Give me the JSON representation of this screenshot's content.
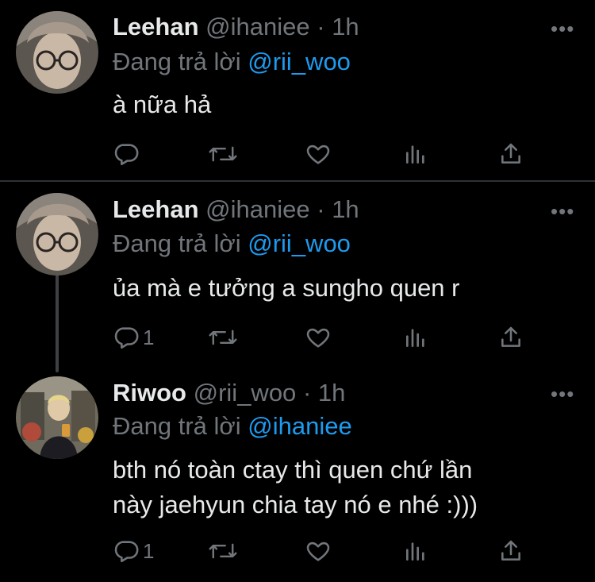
{
  "tweets": [
    {
      "name": "Leehan",
      "handle": "@ihaniee",
      "dot": "·",
      "time": "1h",
      "more": "•••",
      "reply_prefix": "Đang trả lời",
      "reply_mention": "@rii_woo",
      "text": "à nữa hả",
      "reply_count": "",
      "avatar": "leehan-avatar"
    },
    {
      "name": "Leehan",
      "handle": "@ihaniee",
      "dot": "·",
      "time": "1h",
      "more": "•••",
      "reply_prefix": "Đang trả lời",
      "reply_mention": "@rii_woo",
      "text": "ủa mà e tưởng a sungho quen r",
      "reply_count": "1",
      "avatar": "leehan-avatar"
    },
    {
      "name": "Riwoo",
      "handle": "@rii_woo",
      "dot": "·",
      "time": "1h",
      "more": "•••",
      "reply_prefix": "Đang trả lời",
      "reply_mention": "@ihaniee",
      "text": "bth nó toàn ctay thì quen chứ lần\nnày jaehyun chia tay nó e nhé :)))",
      "reply_count": "1",
      "avatar": "riwoo-avatar"
    }
  ],
  "icons": [
    "reply-icon",
    "retweet-icon",
    "like-icon",
    "views-icon",
    "share-icon"
  ],
  "colors": {
    "background": "#000000",
    "text": "#e7e9ea",
    "muted": "#71767b",
    "link": "#1d9bf0",
    "divider": "#2f3336"
  }
}
